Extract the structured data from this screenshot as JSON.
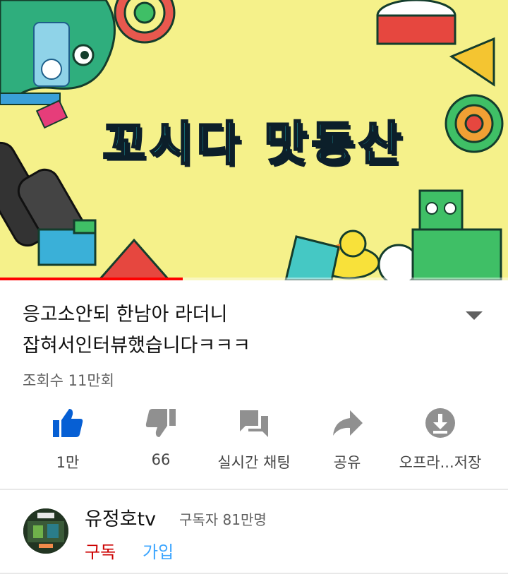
{
  "player": {
    "overlay_title": "꼬시다 맛동산",
    "progress": 0.36
  },
  "video": {
    "title_line1": "응고소안되 한남아 라더니",
    "title_line2": "잡혀서인터뷰했습니다ㅋㅋㅋ",
    "views": "조회수 11만회"
  },
  "actions": [
    {
      "label": "1만",
      "icon": "thumbs-up-icon"
    },
    {
      "label": "66",
      "icon": "thumbs-down-icon"
    },
    {
      "label": "실시간 채팅",
      "icon": "live-chat-icon"
    },
    {
      "label": "공유",
      "icon": "share-icon"
    },
    {
      "label": "오프라...저장",
      "icon": "download-icon"
    }
  ],
  "channel": {
    "name": "유정호tv",
    "subscribers": "구독자 81만명",
    "subscribe_label": "구독",
    "join_label": "가입"
  },
  "colors": {
    "accent_blue": "#065fd4",
    "subscribe_red": "#cc0000",
    "join_blue": "#3ea6ff",
    "progress_red": "#ff0000",
    "icon_gray": "#909090"
  }
}
